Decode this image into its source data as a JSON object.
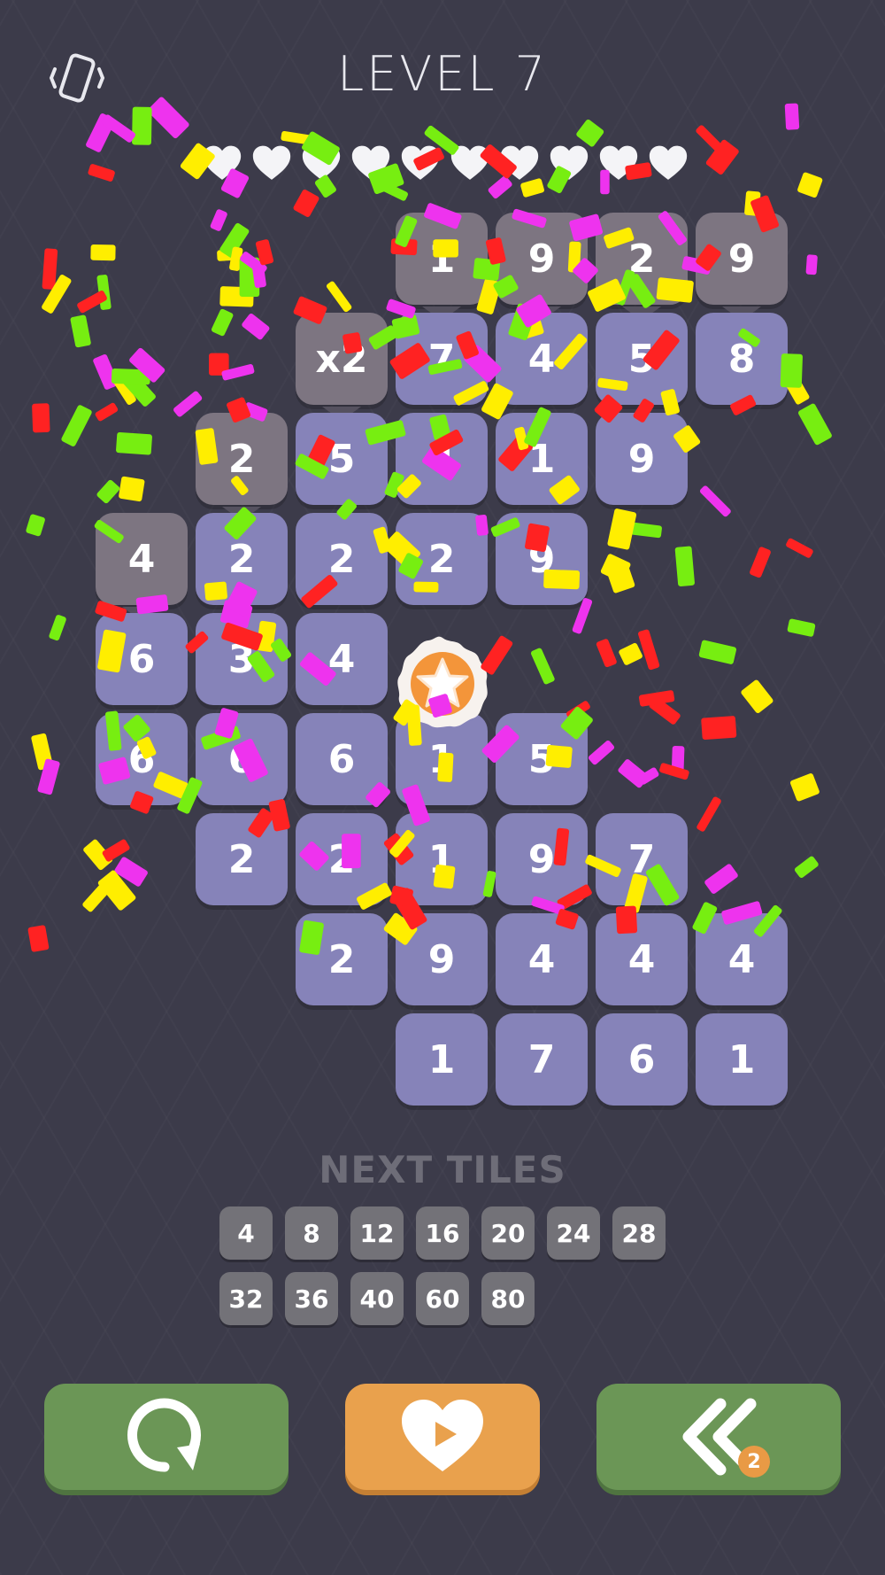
{
  "title": "LEVEL 7",
  "lives": 10,
  "board": {
    "tiles": [
      {
        "v": "1",
        "c": 3,
        "r": 0,
        "gray": true
      },
      {
        "v": "9",
        "c": 4,
        "r": 0,
        "gray": true
      },
      {
        "v": "2",
        "c": 5,
        "r": 0,
        "gray": true
      },
      {
        "v": "9",
        "c": 6,
        "r": 0,
        "gray": true
      },
      {
        "v": "x2",
        "c": 2,
        "r": 1,
        "gray": true
      },
      {
        "v": "7",
        "c": 3,
        "r": 1
      },
      {
        "v": "4",
        "c": 4,
        "r": 1
      },
      {
        "v": "5",
        "c": 5,
        "r": 1
      },
      {
        "v": "8",
        "c": 6,
        "r": 1
      },
      {
        "v": "2",
        "c": 1,
        "r": 2,
        "gray": true
      },
      {
        "v": "5",
        "c": 2,
        "r": 2
      },
      {
        "v": "4",
        "c": 3,
        "r": 2
      },
      {
        "v": "1",
        "c": 4,
        "r": 2
      },
      {
        "v": "9",
        "c": 5,
        "r": 2
      },
      {
        "v": "4",
        "c": 0,
        "r": 3,
        "gray": true
      },
      {
        "v": "2",
        "c": 1,
        "r": 3
      },
      {
        "v": "2",
        "c": 2,
        "r": 3
      },
      {
        "v": "2",
        "c": 3,
        "r": 3
      },
      {
        "v": "9",
        "c": 4,
        "r": 3
      },
      {
        "v": "6",
        "c": 0,
        "r": 4
      },
      {
        "v": "3",
        "c": 1,
        "r": 4
      },
      {
        "v": "4",
        "c": 2,
        "r": 4
      },
      {
        "v": "6",
        "c": 0,
        "r": 5
      },
      {
        "v": "6",
        "c": 1,
        "r": 5
      },
      {
        "v": "6",
        "c": 2,
        "r": 5
      },
      {
        "v": "1",
        "c": 3,
        "r": 5
      },
      {
        "v": "5",
        "c": 4,
        "r": 5
      },
      {
        "v": "2",
        "c": 1,
        "r": 6
      },
      {
        "v": "2",
        "c": 2,
        "r": 6
      },
      {
        "v": "1",
        "c": 3,
        "r": 6
      },
      {
        "v": "9",
        "c": 4,
        "r": 6
      },
      {
        "v": "7",
        "c": 5,
        "r": 6
      },
      {
        "v": "2",
        "c": 2,
        "r": 7
      },
      {
        "v": "9",
        "c": 3,
        "r": 7
      },
      {
        "v": "4",
        "c": 4,
        "r": 7
      },
      {
        "v": "4",
        "c": 5,
        "r": 7
      },
      {
        "v": "4",
        "c": 6,
        "r": 7
      },
      {
        "v": "1",
        "c": 3,
        "r": 8
      },
      {
        "v": "7",
        "c": 4,
        "r": 8
      },
      {
        "v": "6",
        "c": 5,
        "r": 8
      },
      {
        "v": "1",
        "c": 6,
        "r": 8
      }
    ]
  },
  "next_tiles": {
    "label": "NEXT TILES",
    "values": [
      "4",
      "8",
      "12",
      "16",
      "20",
      "24",
      "28",
      "32",
      "36",
      "40",
      "60",
      "80"
    ]
  },
  "buttons": {
    "restart": {
      "icon": "restart-icon"
    },
    "get_life": {
      "icon": "heart-play-icon"
    },
    "undo": {
      "icon": "double-chevron-left-icon",
      "badge": "2"
    }
  },
  "colors": {
    "background": "#3c3b4a",
    "tile": "#8683b9",
    "tile_locked": "#7d7581",
    "button_green": "#6b9656",
    "button_orange": "#e9a14d",
    "confetti": [
      "#ff2222",
      "#ffee00",
      "#77ee11",
      "#ee33ee"
    ]
  }
}
